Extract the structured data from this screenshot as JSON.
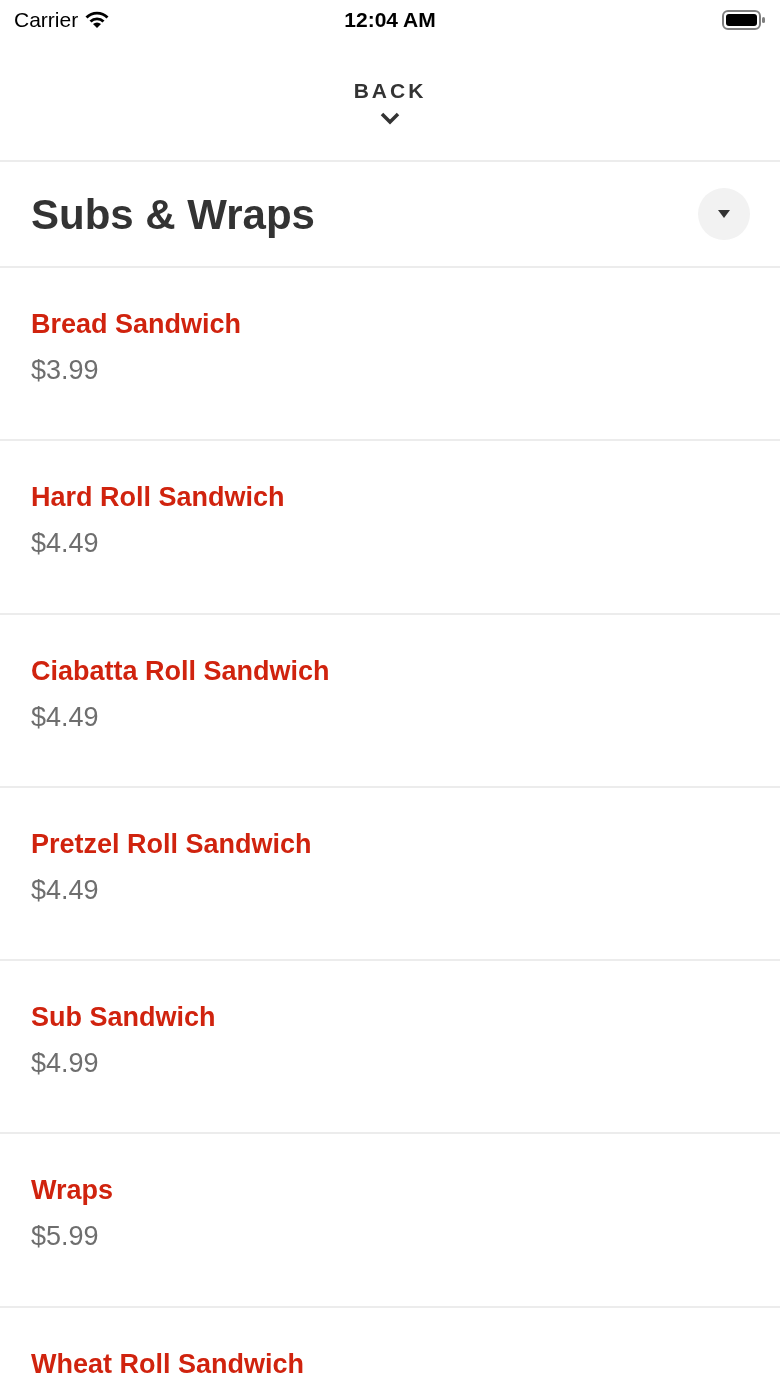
{
  "status_bar": {
    "carrier": "Carrier",
    "time": "12:04 AM"
  },
  "header": {
    "back": "BACK"
  },
  "section": {
    "title": "Subs & Wraps",
    "expanded": true
  },
  "items": [
    {
      "name": "Bread Sandwich",
      "price": "$3.99"
    },
    {
      "name": "Hard Roll Sandwich",
      "price": "$4.49"
    },
    {
      "name": "Ciabatta Roll Sandwich",
      "price": "$4.49"
    },
    {
      "name": "Pretzel Roll Sandwich",
      "price": "$4.49"
    },
    {
      "name": "Sub Sandwich",
      "price": "$4.99"
    },
    {
      "name": "Wraps",
      "price": "$5.99"
    },
    {
      "name": "Wheat Roll Sandwich"
    }
  ]
}
